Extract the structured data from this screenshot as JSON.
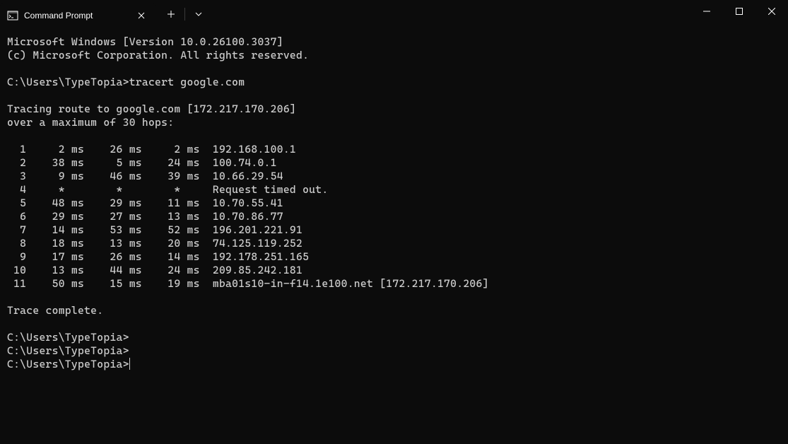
{
  "titlebar": {
    "tab_title": "Command Prompt"
  },
  "terminal": {
    "header_line1": "Microsoft Windows [Version 10.0.26100.3037]",
    "header_line2": "(c) Microsoft Corporation. All rights reserved.",
    "prompt_path": "C:\\Users\\TypeTopia>",
    "command": "tracert google.com",
    "trace_line1": "Tracing route to google.com [172.217.170.206]",
    "trace_line2": "over a maximum of 30 hops:",
    "hops": [
      {
        "n": 1,
        "t1": "2 ms",
        "t2": "26 ms",
        "t3": "2 ms",
        "addr": "192.168.100.1"
      },
      {
        "n": 2,
        "t1": "38 ms",
        "t2": "5 ms",
        "t3": "24 ms",
        "addr": "100.74.0.1"
      },
      {
        "n": 3,
        "t1": "9 ms",
        "t2": "46 ms",
        "t3": "39 ms",
        "addr": "10.66.29.54"
      },
      {
        "n": 4,
        "t1": "*",
        "t2": "*",
        "t3": "*",
        "addr": "Request timed out."
      },
      {
        "n": 5,
        "t1": "48 ms",
        "t2": "29 ms",
        "t3": "11 ms",
        "addr": "10.70.55.41"
      },
      {
        "n": 6,
        "t1": "29 ms",
        "t2": "27 ms",
        "t3": "13 ms",
        "addr": "10.70.86.77"
      },
      {
        "n": 7,
        "t1": "14 ms",
        "t2": "53 ms",
        "t3": "52 ms",
        "addr": "196.201.221.91"
      },
      {
        "n": 8,
        "t1": "18 ms",
        "t2": "13 ms",
        "t3": "20 ms",
        "addr": "74.125.119.252"
      },
      {
        "n": 9,
        "t1": "17 ms",
        "t2": "26 ms",
        "t3": "14 ms",
        "addr": "192.178.251.165"
      },
      {
        "n": 10,
        "t1": "13 ms",
        "t2": "44 ms",
        "t3": "24 ms",
        "addr": "209.85.242.181"
      },
      {
        "n": 11,
        "t1": "50 ms",
        "t2": "15 ms",
        "t3": "19 ms",
        "addr": "mba01s10-in-f14.1e100.net [172.217.170.206]"
      }
    ],
    "trace_complete": "Trace complete."
  }
}
